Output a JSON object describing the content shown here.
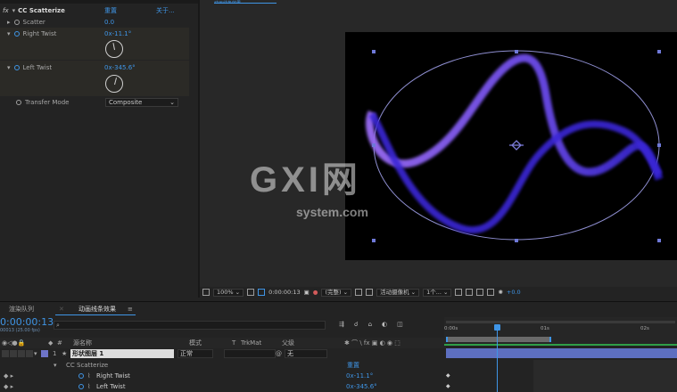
{
  "effects_panel": {
    "fx_label": "fx",
    "effect_name": "CC Scatterize",
    "reset_label": "重置",
    "about_label": "关于...",
    "props": [
      {
        "name": "Scatter",
        "value": "0.0"
      },
      {
        "name": "Right Twist",
        "value": "0x-11.1°"
      },
      {
        "name": "Left Twist",
        "value": "0x-345.6°"
      },
      {
        "name": "Transfer Mode",
        "value": "Composite"
      }
    ],
    "dials": [
      {
        "name": "Right Twist",
        "degrees": -11.1
      },
      {
        "name": "Left Twist",
        "degrees": -345.6
      }
    ]
  },
  "viewer": {
    "top_tab": "动画线条效果",
    "watermark_main": "GXI网",
    "watermark_sub": "system.com",
    "bar": {
      "zoom": "100%",
      "timecode": "0:00:00:13",
      "resolution": "(完整)",
      "camera": "活动摄像机",
      "views": "1个...",
      "exposure": "+0.0"
    }
  },
  "timeline": {
    "tabs": [
      "渲染队列",
      "动画线条效果"
    ],
    "timecode": "0:00:00:13",
    "fps": "00013 (25.00 fps)",
    "search_placeholder": "",
    "columns": {
      "num": "#",
      "source": "源名称",
      "mode": "模式",
      "t": "T",
      "trkmat": "TrkMat",
      "parent": "父级"
    },
    "layer": {
      "num": "1",
      "name": "形状图层 1",
      "mode": "正常",
      "parent": "无"
    },
    "effect": {
      "name": "CC Scatterize",
      "reset": "重置"
    },
    "sub_props": [
      {
        "name": "Right Twist",
        "value": "0x-11.1°"
      },
      {
        "name": "Left Twist",
        "value": "0x-345.6°"
      }
    ],
    "ruler": {
      "labels": [
        "0:00s",
        "01s",
        "02s"
      ]
    }
  },
  "colors": {
    "accent": "#3f95e6",
    "layer_bar": "#5d6fc0",
    "curve": "#7a5cf0"
  }
}
